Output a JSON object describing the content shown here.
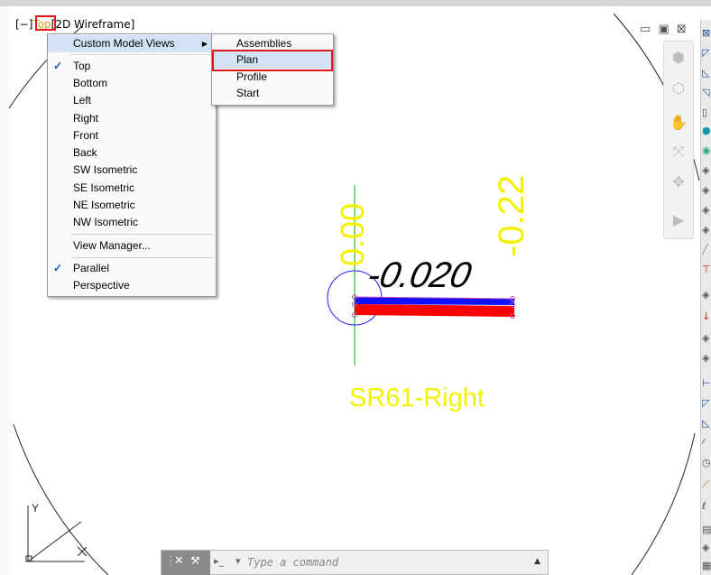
{
  "viewport": {
    "minus_bracket": "[−]",
    "view_label": "Top",
    "visual_style": "[2D Wireframe]"
  },
  "window_controls": [
    "restore-icon",
    "maximize-icon",
    "close-icon"
  ],
  "view_menu": {
    "custom_views_label": "Custom Model Views",
    "items": [
      {
        "label": "Top",
        "checked": true
      },
      {
        "label": "Bottom",
        "checked": false
      },
      {
        "label": "Left",
        "checked": false
      },
      {
        "label": "Right",
        "checked": false
      },
      {
        "label": "Front",
        "checked": false
      },
      {
        "label": "Back",
        "checked": false
      },
      {
        "label": "SW Isometric",
        "checked": false
      },
      {
        "label": "SE Isometric",
        "checked": false
      },
      {
        "label": "NE Isometric",
        "checked": false
      },
      {
        "label": "NW Isometric",
        "checked": false
      }
    ],
    "view_manager": "View Manager...",
    "projection": [
      {
        "label": "Parallel",
        "checked": true
      },
      {
        "label": "Perspective",
        "checked": false
      }
    ]
  },
  "custom_views_submenu": {
    "items": [
      "Assemblies",
      "Plan",
      "Profile",
      "Start"
    ],
    "highlighted": "Plan"
  },
  "drawing": {
    "label_zero": "0.00",
    "label_slope": "-0.22",
    "label_grade": "-0.020",
    "label_name": "SR61-Right",
    "colors": {
      "annotation": "#f2f200",
      "blue_band": "#1010ff",
      "red_band": "#ff0000",
      "grip": "#c050c0",
      "axis": "#00b000",
      "circle": "#2020ff"
    }
  },
  "command_line": {
    "close_glyph": "✕",
    "wrench_glyph": "🔧",
    "prompt_glyph": "▸_",
    "placeholder": "Type a command",
    "history_glyph": "▲"
  },
  "ucs": {
    "y_label": "Y",
    "x_label": "X"
  }
}
